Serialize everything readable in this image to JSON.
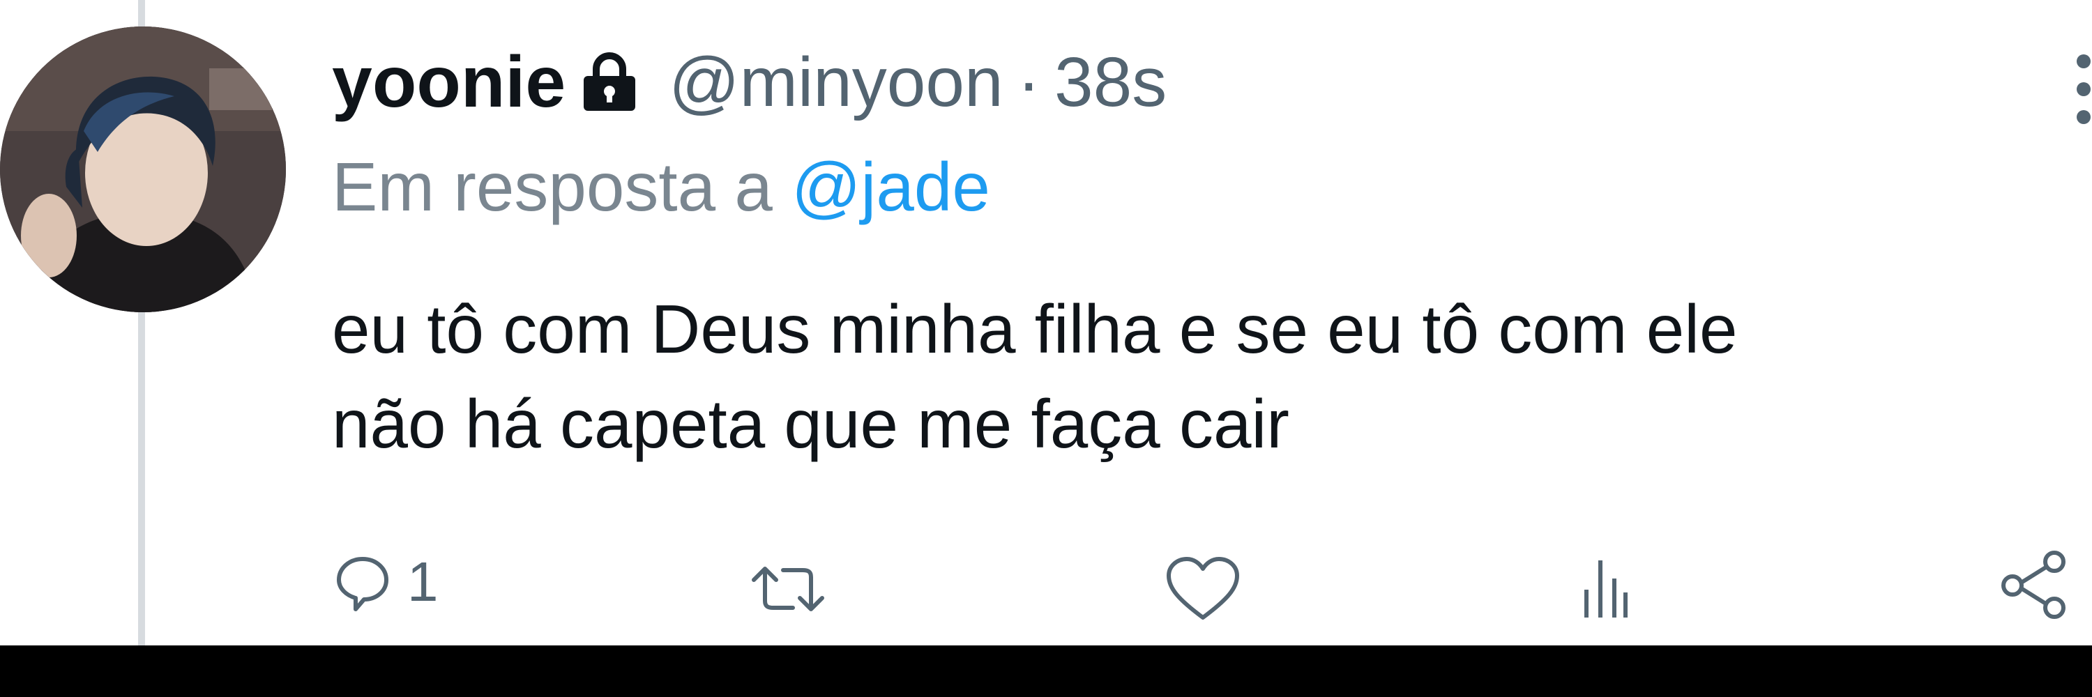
{
  "tweet": {
    "display_name": "yoonie",
    "handle": "@minyoon",
    "separator": "·",
    "time": "38s",
    "reply_prefix": "Em resposta a",
    "reply_to": "@jade",
    "text_lines": [
      "eu tô com Deus minha filha e se eu tô com ele",
      "não há capeta que me faça cair"
    ]
  },
  "actions": {
    "reply_count": "1",
    "icons": [
      "reply-icon",
      "retweet-icon",
      "like-icon",
      "views-icon",
      "share-icon"
    ]
  },
  "colors": {
    "text": "#0f1419",
    "secondary": "#536471",
    "link": "#1d9bf0",
    "thread_line": "#d7dbdf"
  }
}
